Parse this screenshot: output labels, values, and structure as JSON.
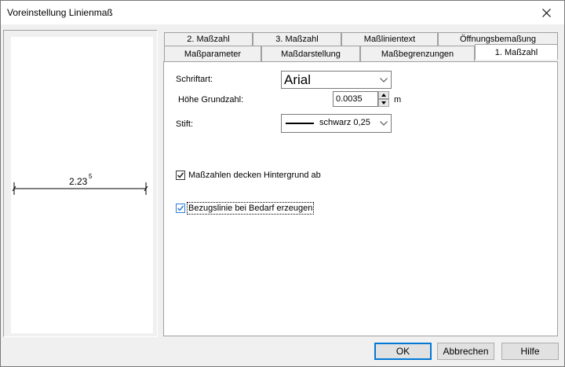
{
  "window": {
    "title": "Voreinstellung Linienmaß"
  },
  "preview": {
    "dimension_text": "2.23",
    "superscript": "5"
  },
  "tabs": {
    "row_back": [
      "2. Maßzahl",
      "3. Maßzahl",
      "Maßlinientext",
      "Öffnungsbemaßung"
    ],
    "row_front": [
      "Maßparameter",
      "Maßdarstellung",
      "Maßbegrenzungen",
      "1. Maßzahl"
    ],
    "active": "1. Maßzahl"
  },
  "form": {
    "font_label": "Schriftart:",
    "font_value": "Arial",
    "height_label": "Höhe Grundzahl:",
    "height_value": "0.0035",
    "height_unit": "m",
    "pen_label": "Stift:",
    "pen_value": "schwarz 0,25",
    "cb_background_label": "Maßzahlen decken Hintergrund ab",
    "cb_background_checked": true,
    "cb_reference_label": "Bezugslinie bei Bedarf erzeugen",
    "cb_reference_checked": true
  },
  "buttons": {
    "ok": "OK",
    "cancel": "Abbrechen",
    "help": "Hilfe"
  },
  "icons": [
    "close-icon",
    "chevron-down-icon",
    "spin-up-icon",
    "spin-down-icon",
    "checkmark-icon"
  ],
  "colors": {
    "accent": "#0078d7",
    "checkbox_check": "#1e1e1e",
    "focus_check": "#2f7fd8"
  }
}
